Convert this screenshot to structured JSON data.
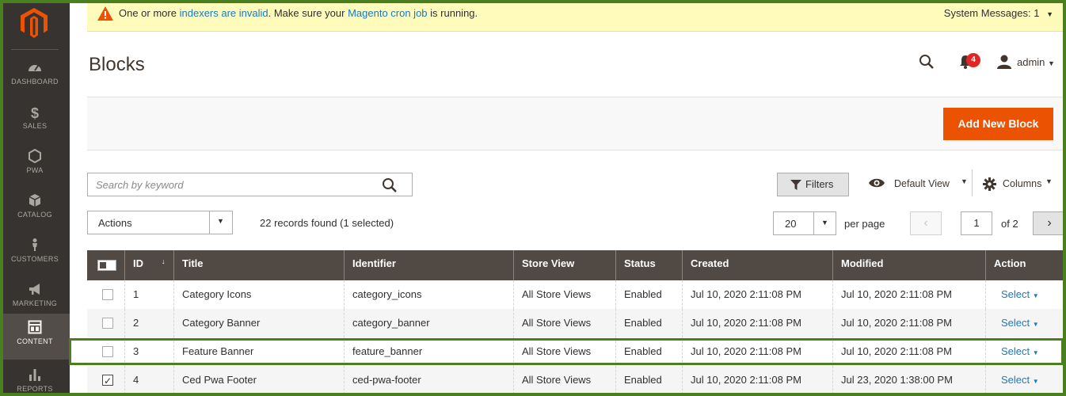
{
  "sidebar": {
    "logo": "magento-logo",
    "items": [
      {
        "label": "DASHBOARD",
        "icon": "dashboard-icon"
      },
      {
        "label": "SALES",
        "icon": "dollar-icon"
      },
      {
        "label": "PWA",
        "icon": "hexagon-icon"
      },
      {
        "label": "CATALOG",
        "icon": "box-icon"
      },
      {
        "label": "CUSTOMERS",
        "icon": "person-icon"
      },
      {
        "label": "MARKETING",
        "icon": "megaphone-icon"
      },
      {
        "label": "CONTENT",
        "icon": "layout-icon"
      },
      {
        "label": "REPORTS",
        "icon": "bar-chart-icon"
      }
    ],
    "active": "CONTENT"
  },
  "banner": {
    "prefix": "One or more",
    "link1": "indexers are invalid",
    "middle": ". Make sure your",
    "link2": "Magento cron job",
    "suffix": "is running.",
    "system_messages": "System Messages: 1"
  },
  "header": {
    "title": "Blocks",
    "notification_count": "4",
    "user": "admin"
  },
  "toolbar": {
    "add_button": "Add New Block",
    "search_placeholder": "Search by keyword",
    "filters": "Filters",
    "view": "Default View",
    "columns": "Columns",
    "actions": "Actions",
    "records": "22 records found (1 selected)",
    "per_page_value": "20",
    "per_page_label": "per page",
    "page": "1",
    "of_pages": "of 2"
  },
  "grid": {
    "columns": [
      "ID",
      "Title",
      "Identifier",
      "Store View",
      "Status",
      "Created",
      "Modified",
      "Action"
    ],
    "rows": [
      {
        "checked": false,
        "id": "1",
        "title": "Category Icons",
        "identifier": "category_icons",
        "store": "All Store Views",
        "status": "Enabled",
        "created": "Jul 10, 2020 2:11:08 PM",
        "modified": "Jul 10, 2020 2:11:08 PM",
        "action": "Select"
      },
      {
        "checked": false,
        "id": "2",
        "title": "Category Banner",
        "identifier": "category_banner",
        "store": "All Store Views",
        "status": "Enabled",
        "created": "Jul 10, 2020 2:11:08 PM",
        "modified": "Jul 10, 2020 2:11:08 PM",
        "action": "Select"
      },
      {
        "checked": false,
        "id": "3",
        "title": "Feature Banner",
        "identifier": "feature_banner",
        "store": "All Store Views",
        "status": "Enabled",
        "created": "Jul 10, 2020 2:11:08 PM",
        "modified": "Jul 10, 2020 2:11:08 PM",
        "action": "Select"
      },
      {
        "checked": true,
        "id": "4",
        "title": "Ced Pwa Footer",
        "identifier": "ced-pwa-footer",
        "store": "All Store Views",
        "status": "Enabled",
        "created": "Jul 10, 2020 2:11:08 PM",
        "modified": "Jul 23, 2020 1:38:00 PM",
        "action": "Select"
      }
    ]
  },
  "colors": {
    "accent": "#eb5202",
    "sidebar": "#373330",
    "grid_header": "#514943",
    "link": "#1979c3",
    "highlight": "#4a7f1f"
  }
}
